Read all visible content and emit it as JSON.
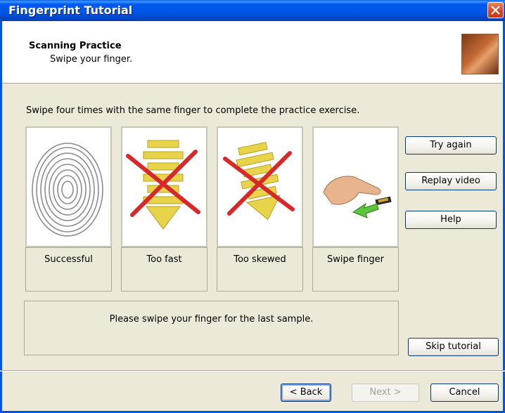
{
  "window": {
    "title": "Fingerprint Tutorial"
  },
  "header": {
    "title": "Scanning Practice",
    "subtitle": "Swipe your finger."
  },
  "instructions": "Swipe four times with the same finger to complete the practice exercise.",
  "panels": [
    {
      "caption": "Successful",
      "icon": "fingerprint-image"
    },
    {
      "caption": "Too fast",
      "icon": "too-fast-arrow-x-image"
    },
    {
      "caption": "Too skewed",
      "icon": "too-skewed-arrow-x-image"
    },
    {
      "caption": "Swipe finger",
      "icon": "hand-swipe-image"
    }
  ],
  "side_buttons": {
    "try_again": "Try again",
    "replay_video": "Replay video",
    "help": "Help"
  },
  "status_message": "Please swipe your finger for the last sample.",
  "skip_button": "Skip tutorial",
  "nav": {
    "back": "< Back",
    "next": "Next >",
    "cancel": "Cancel"
  },
  "colors": {
    "titlebar": "#0055E5",
    "background": "#ECE9D8",
    "close_button": "#D6421E"
  }
}
